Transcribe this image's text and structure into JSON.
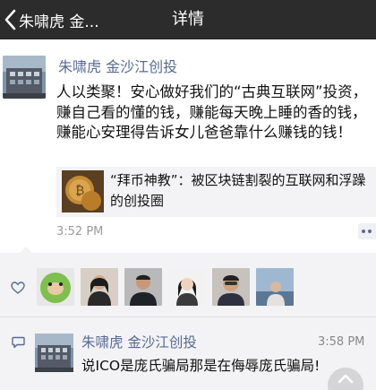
{
  "nav": {
    "back_label": "朱啸虎 金...",
    "title": "详情"
  },
  "post": {
    "author": "朱啸虎 金沙江创投",
    "body": "人以类聚！安心做好我们的“古典互联网”投资，赚自己看的懂的钱，赚能每天晚上睡的香的钱，赚能心安理得告诉女儿爸爸靠什么赚钱的钱！",
    "link": {
      "title": "“拜币神教”：被区块链割裂的互联网和浮躁的创投圈"
    },
    "time": "3:52 PM"
  },
  "comment": {
    "author": "朱啸虎 金沙江创投",
    "time": "3:58 PM",
    "text": "说ICO是庞氏骗局那是在侮辱庞氏骗局!"
  },
  "colors": {
    "nav_bg": "#2c2c2c",
    "link_blue": "#576b95",
    "panel_bg": "#f3f3f5"
  },
  "icons": {
    "back": "chevron-left-icon",
    "like": "heart-outline-icon",
    "comment": "comment-bubble-icon",
    "more": "more-dots-icon"
  }
}
